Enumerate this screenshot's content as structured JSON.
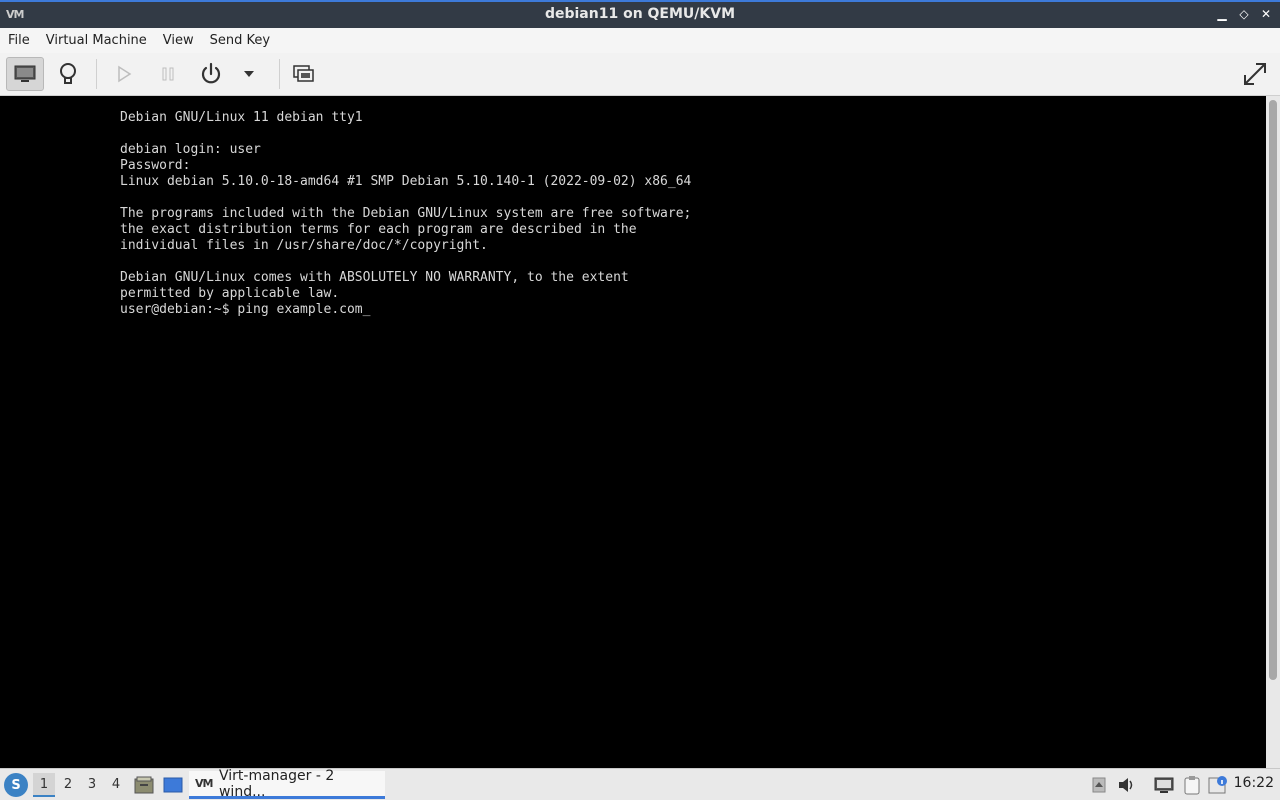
{
  "window": {
    "title": "debian11 on QEMU/KVM",
    "app_icon": "VM",
    "buttons": {
      "minimize": "▁",
      "maximize": "◇",
      "close": "✕"
    }
  },
  "menu": {
    "items": [
      "File",
      "Virtual Machine",
      "View",
      "Send Key"
    ]
  },
  "toolbar": {
    "buttons": [
      "console-view-icon",
      "details-lightbulb-icon",
      "run-icon",
      "pause-icon",
      "power-icon",
      "power-dropdown-icon",
      "snapshots-icon",
      "fullscreen-icon"
    ]
  },
  "console": {
    "text": "Debian GNU/Linux 11 debian tty1\n\ndebian login: user\nPassword:\nLinux debian 5.10.0-18-amd64 #1 SMP Debian 5.10.140-1 (2022-09-02) x86_64\n\nThe programs included with the Debian GNU/Linux system are free software;\nthe exact distribution terms for each program are described in the\nindividual files in /usr/share/doc/*/copyright.\n\nDebian GNU/Linux comes with ABSOLUTELY NO WARRANTY, to the extent\npermitted by applicable law.\nuser@debian:~$ ping example.com_"
  },
  "taskbar": {
    "start_icon": "S",
    "workspaces": [
      "1",
      "2",
      "3",
      "4"
    ],
    "active_workspace": "1",
    "task_icon": "VM",
    "task_label": "Virt-manager - 2 wind...",
    "clock": "16:22"
  },
  "colors": {
    "accent": "#3d7ad9",
    "titlebar": "#323a45",
    "console_bg": "#000000",
    "console_fg": "#d8d8d8"
  }
}
